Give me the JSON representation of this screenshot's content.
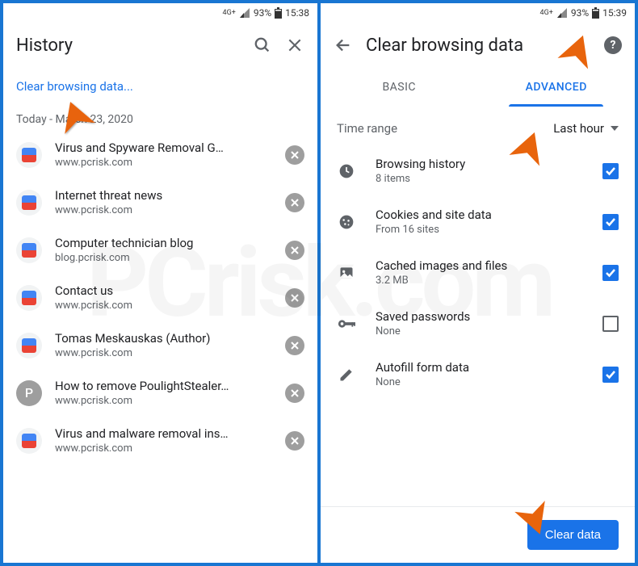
{
  "status": {
    "network": "4G+",
    "battery_pct": "93%",
    "time_left": "15:38",
    "time_right": "15:39"
  },
  "left": {
    "title": "History",
    "clear_link": "Clear browsing data...",
    "date": "Today - March 23, 2020",
    "items": [
      {
        "title": "Virus and Spyware Removal G…",
        "url": "www.pcrisk.com",
        "icon": "pcrisk"
      },
      {
        "title": "Internet threat news",
        "url": "www.pcrisk.com",
        "icon": "pcrisk"
      },
      {
        "title": "Computer technician blog",
        "url": "blog.pcrisk.com",
        "icon": "pcrisk"
      },
      {
        "title": "Contact us",
        "url": "www.pcrisk.com",
        "icon": "pcrisk"
      },
      {
        "title": "Tomas Meskauskas (Author)",
        "url": "www.pcrisk.com",
        "icon": "pcrisk"
      },
      {
        "title": "How to remove PoulightStealer…",
        "url": "www.pcrisk.com",
        "icon": "letter-p"
      },
      {
        "title": "Virus and malware removal ins…",
        "url": "www.pcrisk.com",
        "icon": "pcrisk"
      }
    ]
  },
  "right": {
    "title": "Clear browsing data",
    "tabs": {
      "basic": "BASIC",
      "advanced": "ADVANCED"
    },
    "active_tab": "advanced",
    "time_range_label": "Time range",
    "time_range_value": "Last hour",
    "options": [
      {
        "icon": "clock",
        "title": "Browsing history",
        "sub": "8 items",
        "checked": true
      },
      {
        "icon": "cookie",
        "title": "Cookies and site data",
        "sub": "From 16 sites",
        "checked": true
      },
      {
        "icon": "image",
        "title": "Cached images and files",
        "sub": "3.2 MB",
        "checked": true
      },
      {
        "icon": "key",
        "title": "Saved passwords",
        "sub": "None",
        "checked": false
      },
      {
        "icon": "pencil",
        "title": "Autofill form data",
        "sub": "None",
        "checked": true
      }
    ],
    "clear_button": "Clear data"
  },
  "watermark": "PCrisk.com"
}
